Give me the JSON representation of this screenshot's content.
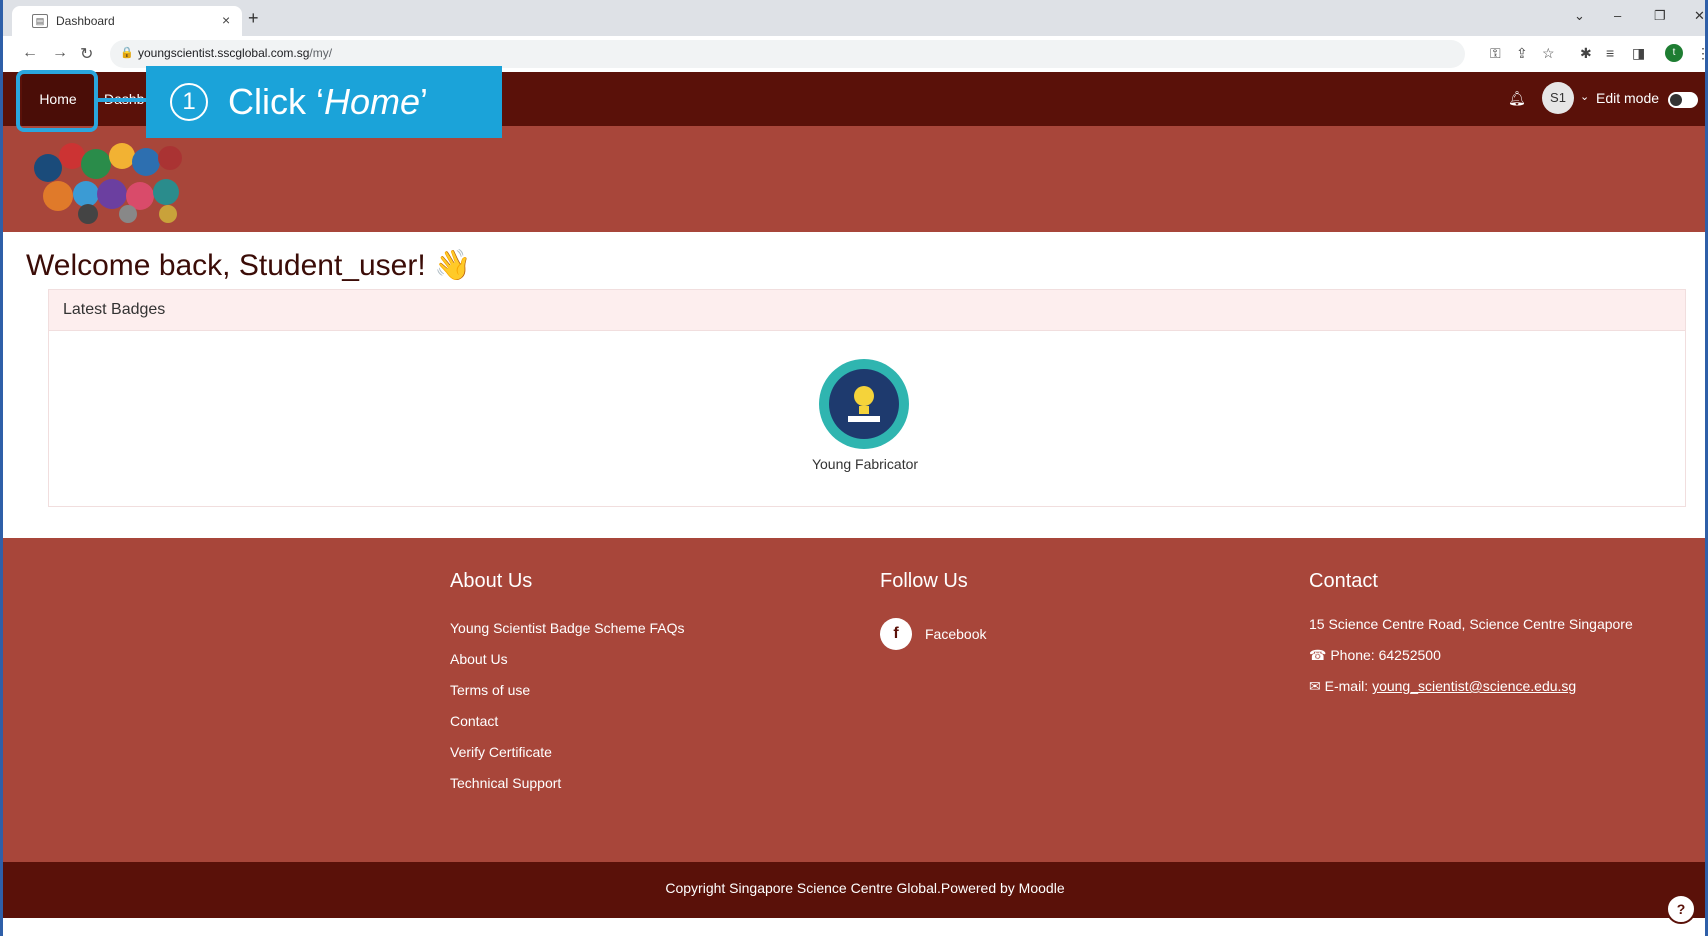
{
  "browser": {
    "tab_title": "Dashboard",
    "tab_close": "×",
    "new_tab": "+",
    "url_host": "youngscientist.sscglobal.com.sg",
    "url_path": "/my/",
    "profile_initial": "t"
  },
  "navbar": {
    "home_label": "Home",
    "dashboard_label_partial": "Dashb",
    "avatar_initials": "S1",
    "edit_mode_label": "Edit mode"
  },
  "callout": {
    "number": "1",
    "text_prefix": "Click ‘",
    "text_em": "Home",
    "text_suffix": "’"
  },
  "main": {
    "welcome": "Welcome back, Student_user! 👋",
    "card_title": "Latest Badges",
    "badge_name": "Young Fabricator"
  },
  "footer": {
    "about": {
      "heading": "About Us",
      "links": [
        "Young Scientist Badge Scheme FAQs",
        "About Us",
        "Terms of use",
        "Contact",
        "Verify Certificate",
        "Technical Support"
      ]
    },
    "follow": {
      "heading": "Follow Us",
      "facebook": "Facebook"
    },
    "contact": {
      "heading": "Contact",
      "address": "15 Science Centre Road, Science Centre Singapore",
      "phone": "Phone: 64252500",
      "email_label": "E-mail: ",
      "email": "young_scientist@science.edu.sg"
    },
    "copyright": "Copyright Singapore Science Centre Global.Powered by Moodle",
    "help": "?"
  },
  "colors": {
    "navbar": "#5a1109",
    "header_band": "#a8463a",
    "callout": "#1ba3d9",
    "card_header": "#fdeeee"
  }
}
